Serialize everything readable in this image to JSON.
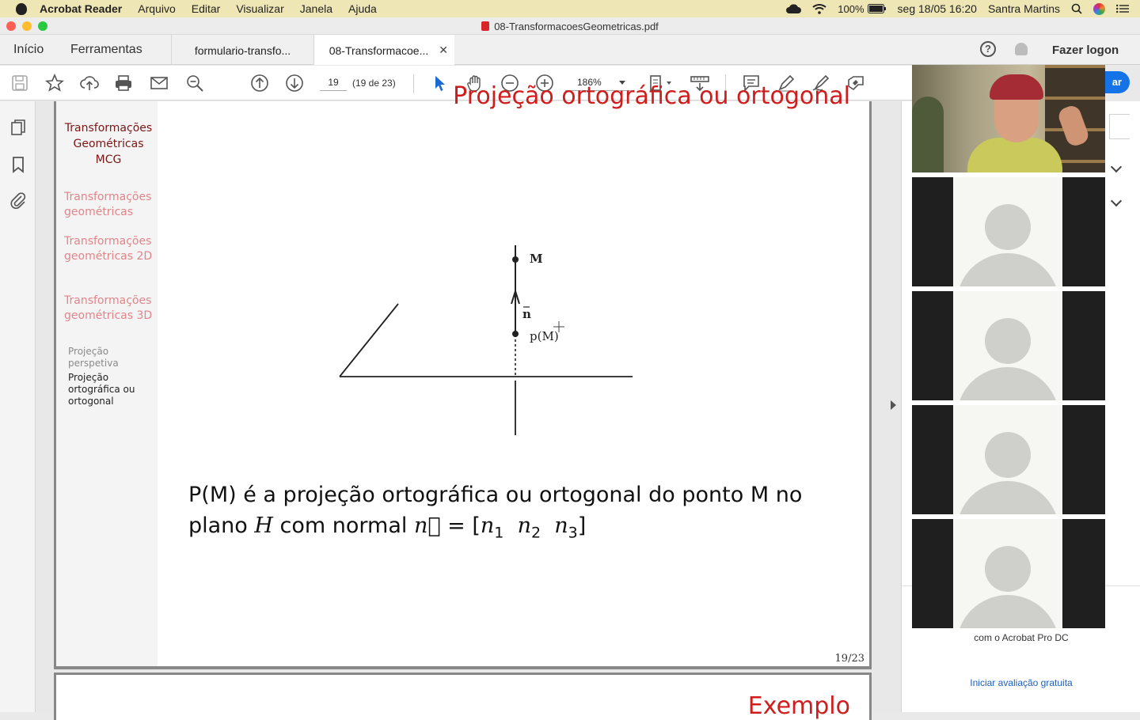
{
  "menubar": {
    "app_name": "Acrobat Reader",
    "items": [
      "Arquivo",
      "Editar",
      "Visualizar",
      "Janela",
      "Ajuda"
    ],
    "battery": "100%",
    "datetime": "seg 18/05  16:20",
    "user": "Santra Martins"
  },
  "window": {
    "title": "08-TransformacoesGeometricas.pdf"
  },
  "tabs": {
    "home": "Início",
    "tools": "Ferramentas",
    "doc1": "formulario-transfo...",
    "doc2": "08-Transformacoe...",
    "logon": "Fazer logon",
    "help": "?"
  },
  "toolbar": {
    "page_current": "19",
    "page_count": "(19 de 23)",
    "zoom": "186%"
  },
  "slide": {
    "nav_title": "Transformações Geométricas MCG",
    "nav_sections": [
      "Transformações geométricas",
      "Transformações geométricas 2D",
      "Transformações geométricas 3D"
    ],
    "nav_sub": [
      "Projeção perspetiva",
      "Projeção ortográfica ou ortogonal"
    ],
    "title": "Projeção ortográfica ou ortogonal",
    "diagram_labels": {
      "point": "M",
      "normal": "n",
      "projection": "p(M)"
    },
    "body_line1": "P(M) é a projeção ortográfica ou ortogonal do ponto M no",
    "body_line2_prefix": "plano ",
    "body_line2_H": "H",
    "body_line2_mid": " com normal ",
    "body_line2_vec": "n⃗",
    "body_line2_eq": " = [",
    "n1": "n",
    "n1_sub": "1",
    "n2": "n",
    "n2_sub": "2",
    "n3": "n",
    "n3_sub": "3",
    "body_line2_close": "]",
    "page_number": "19/23",
    "next_title": "Exemplo"
  },
  "right_pane": {
    "promo": "com o Acrobat Pro DC",
    "trial_link": "Iniciar avaliação gratuita",
    "partial_button": "ar"
  },
  "colors": {
    "menubar_bg": "#efe6b6",
    "slide_title": "#cf1d1d",
    "nav_title": "#7a1614",
    "nav_section": "#e0858a",
    "link": "#1b5fc1",
    "acrobat_blue": "#1473e6"
  }
}
